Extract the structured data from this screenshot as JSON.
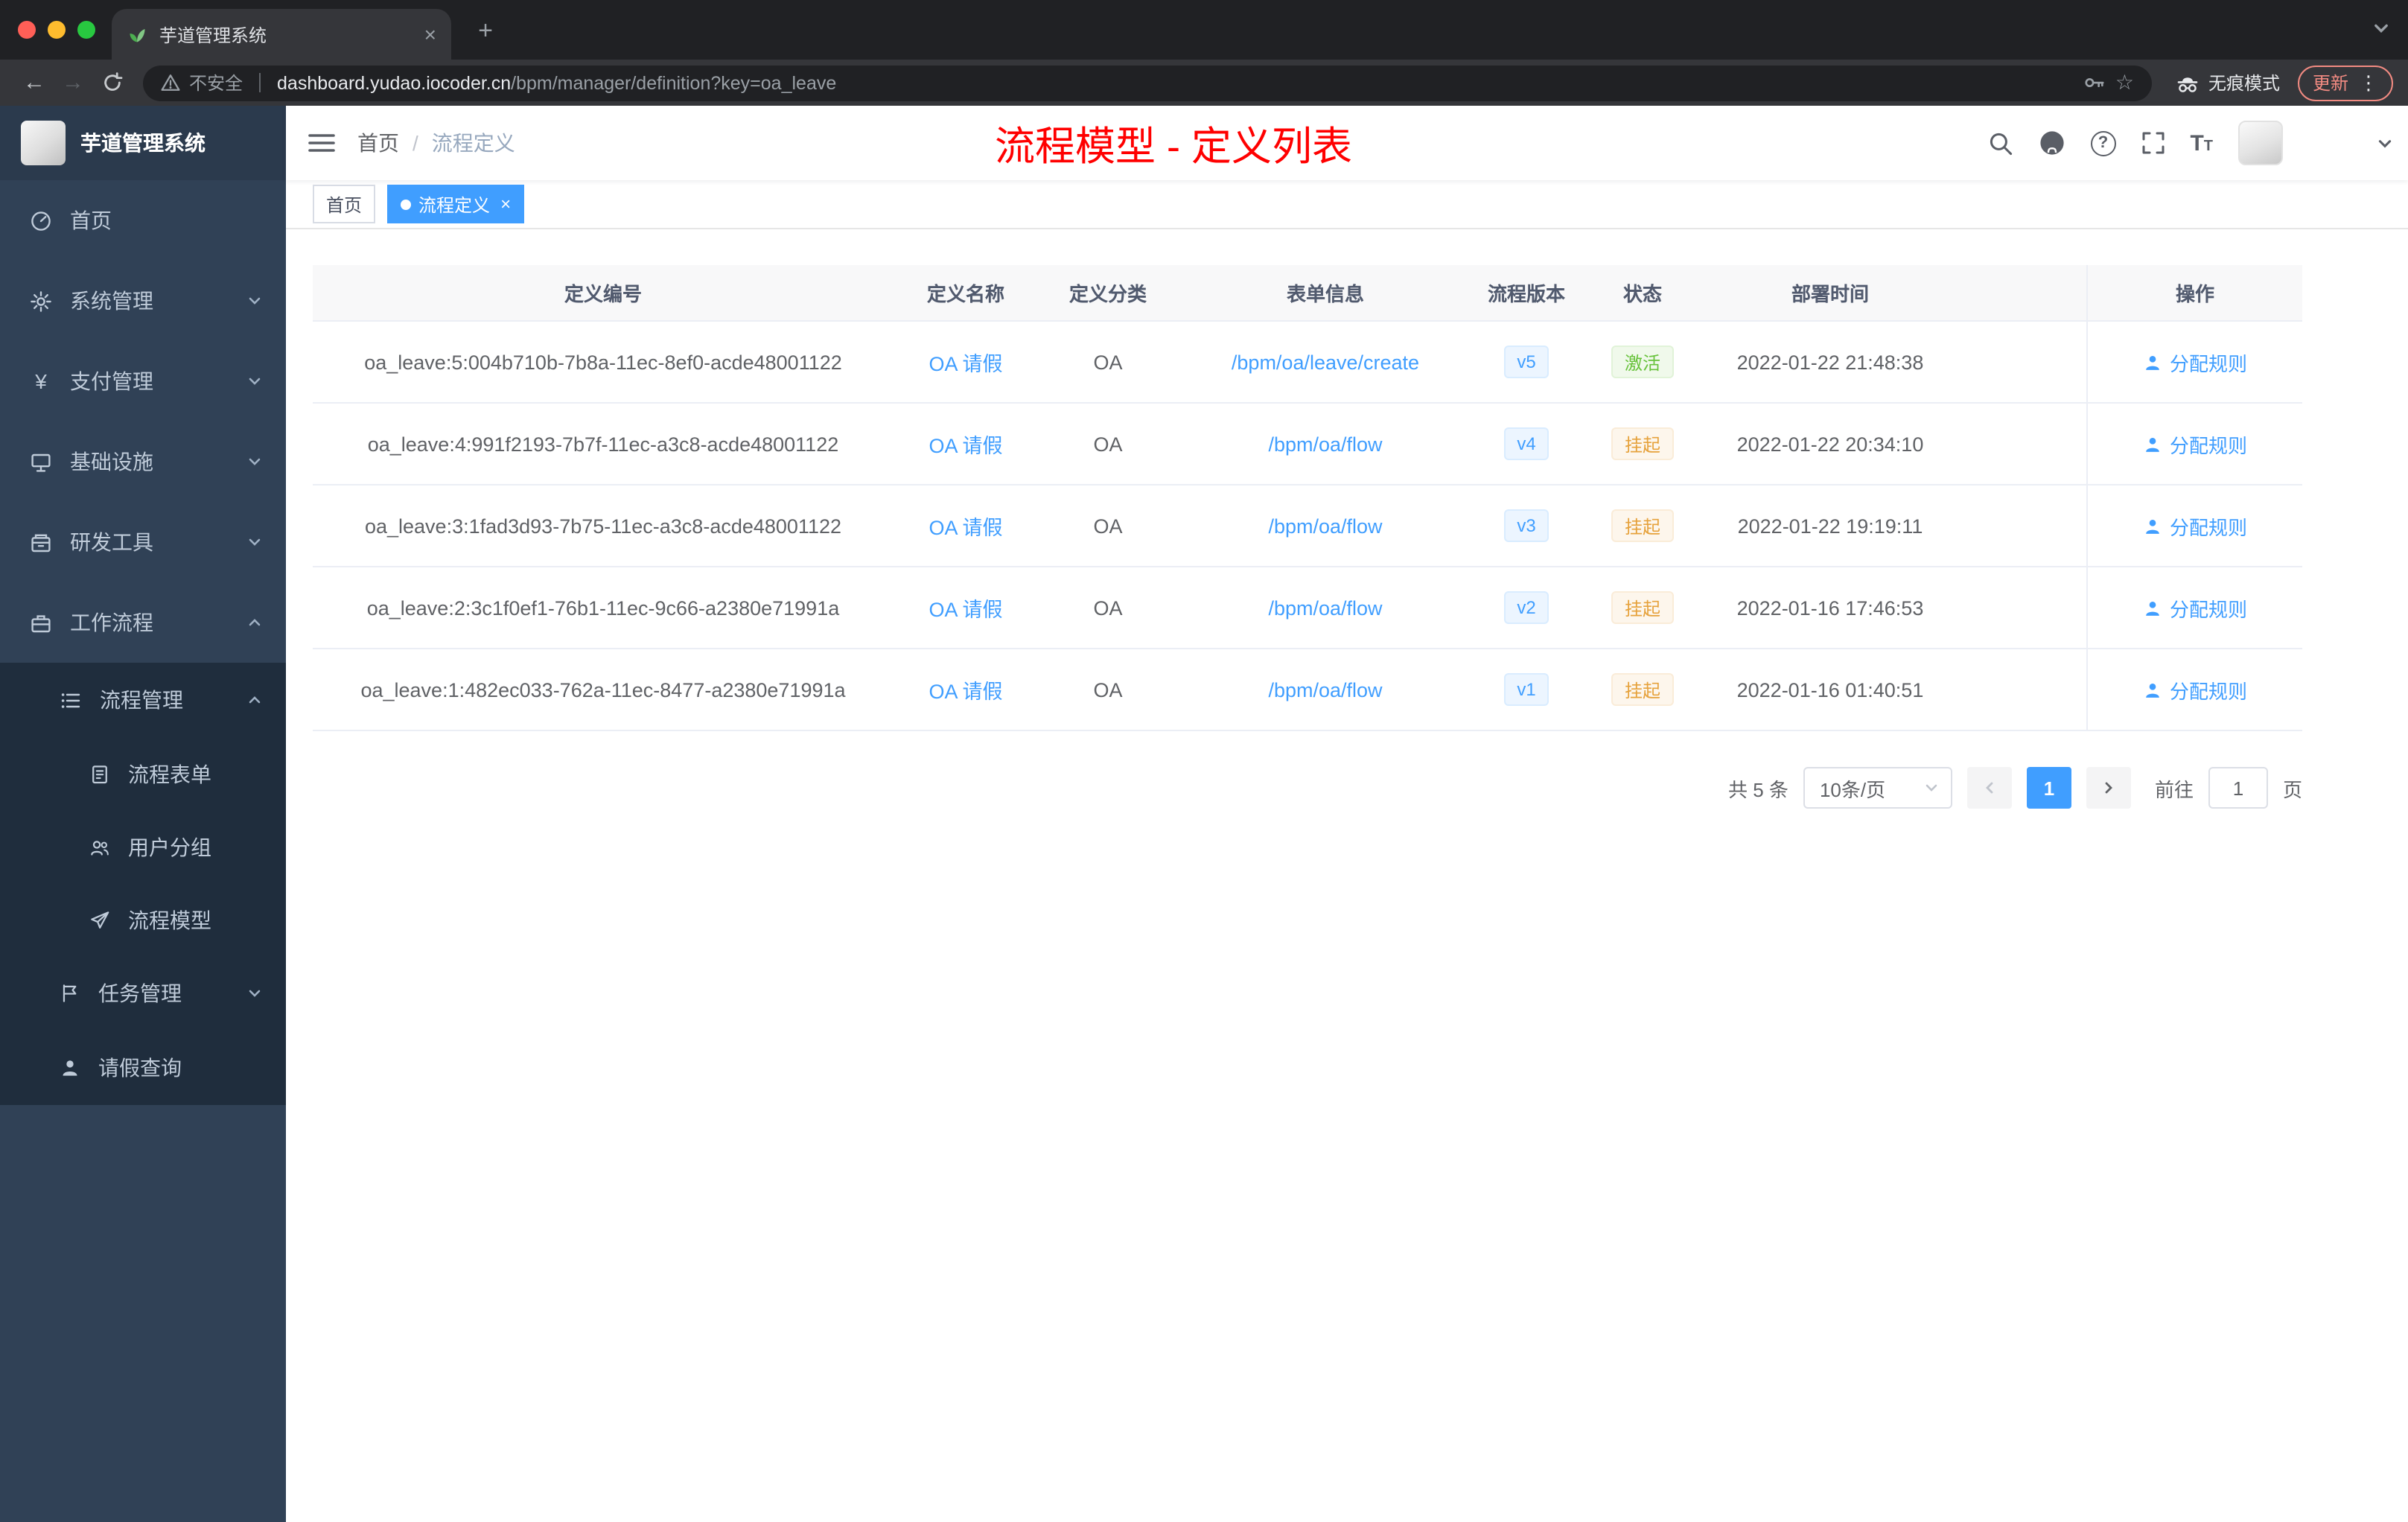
{
  "colors": {
    "accent": "#409eff",
    "title_red": "#ff0000",
    "success": "#67c23a",
    "warning": "#e6a23c",
    "sidebar_bg": "#304156",
    "submenu_bg": "#1f2d3d"
  },
  "browser": {
    "tab_title": "芋道管理系统",
    "security": "不安全",
    "url_host": "dashboard.yudao.iocoder.cn",
    "url_path": "/bpm/manager/definition?key=oa_leave",
    "incognito": "无痕模式",
    "update": "更新"
  },
  "sidebar": {
    "title": "芋道管理系统",
    "items": [
      {
        "label": "首页"
      },
      {
        "label": "系统管理"
      },
      {
        "label": "支付管理"
      },
      {
        "label": "基础设施"
      },
      {
        "label": "研发工具"
      },
      {
        "label": "工作流程"
      }
    ],
    "submenu": {
      "group1": "流程管理",
      "children": [
        {
          "label": "流程表单"
        },
        {
          "label": "用户分组"
        },
        {
          "label": "流程模型"
        }
      ],
      "group2": "任务管理",
      "leave": "请假查询"
    }
  },
  "header": {
    "breadcrumb": [
      "首页",
      "流程定义"
    ],
    "separator": "/",
    "title": "流程模型 - 定义列表"
  },
  "tags": {
    "home": "首页",
    "active": "流程定义"
  },
  "table": {
    "headers": [
      "定义编号",
      "定义名称",
      "定义分类",
      "表单信息",
      "流程版本",
      "状态",
      "部署时间",
      "操作"
    ],
    "rows": [
      {
        "id": "oa_leave:5:004b710b-7b8a-11ec-8ef0-acde48001122",
        "name": "OA 请假",
        "category": "OA",
        "form": "/bpm/oa/leave/create",
        "version": "v5",
        "status": "激活",
        "time": "2022-01-22 21:48:38",
        "action": "分配规则"
      },
      {
        "id": "oa_leave:4:991f2193-7b7f-11ec-a3c8-acde48001122",
        "name": "OA 请假",
        "category": "OA",
        "form": "/bpm/oa/flow",
        "version": "v4",
        "status": "挂起",
        "time": "2022-01-22 20:34:10",
        "action": "分配规则"
      },
      {
        "id": "oa_leave:3:1fad3d93-7b75-11ec-a3c8-acde48001122",
        "name": "OA 请假",
        "category": "OA",
        "form": "/bpm/oa/flow",
        "version": "v3",
        "status": "挂起",
        "time": "2022-01-22 19:19:11",
        "action": "分配规则"
      },
      {
        "id": "oa_leave:2:3c1f0ef1-76b1-11ec-9c66-a2380e71991a",
        "name": "OA 请假",
        "category": "OA",
        "form": "/bpm/oa/flow",
        "version": "v2",
        "status": "挂起",
        "time": "2022-01-16 17:46:53",
        "action": "分配规则"
      },
      {
        "id": "oa_leave:1:482ec033-762a-11ec-8477-a2380e71991a",
        "name": "OA 请假",
        "category": "OA",
        "form": "/bpm/oa/flow",
        "version": "v1",
        "status": "挂起",
        "time": "2022-01-16 01:40:51",
        "action": "分配规则"
      }
    ]
  },
  "pagination": {
    "total": "共 5 条",
    "page_size": "10条/页",
    "page": "1",
    "goto": "前往",
    "goto_value": "1",
    "unit": "页"
  }
}
